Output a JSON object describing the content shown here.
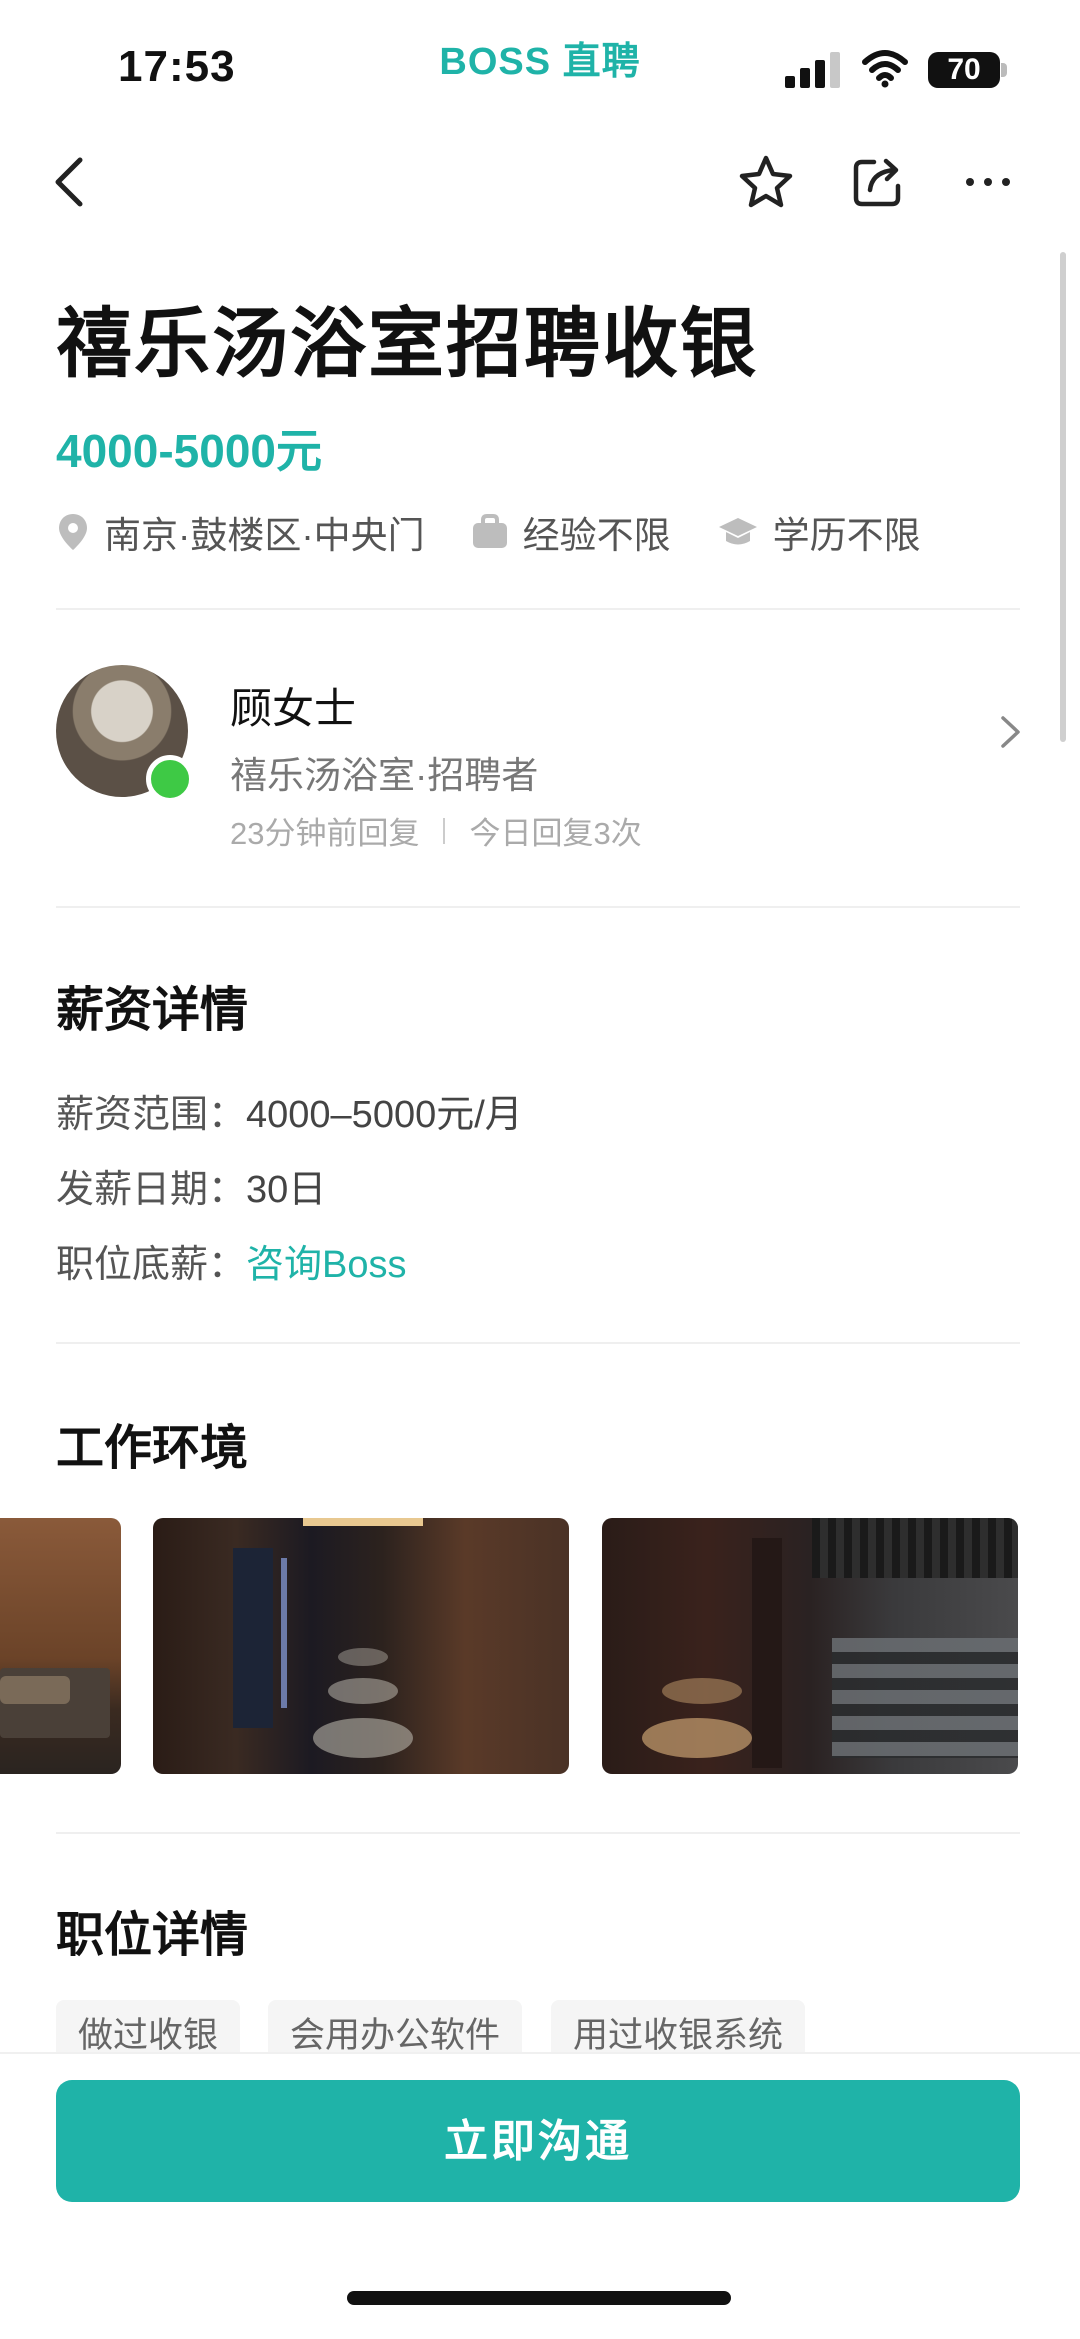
{
  "status_bar": {
    "time": "17:53",
    "brand": "BOSS 直聘",
    "battery": "70"
  },
  "nav": {
    "back_icon": "chevron-left-icon",
    "icons": [
      "star-icon",
      "share-icon",
      "more-icon"
    ]
  },
  "job": {
    "title": "禧乐汤浴室招聘收银",
    "salary": "4000-5000元",
    "location": "南京·鼓楼区·中央门",
    "experience": "经验不限",
    "education": "学历不限"
  },
  "recruiter": {
    "name": "顾女士",
    "company": "禧乐汤浴室·招聘者",
    "reply_time": "23分钟前回复",
    "reply_count": "今日回复3次",
    "online_color": "#3ec945"
  },
  "salary_details": {
    "title": "薪资详情",
    "range_label": "薪资范围：",
    "range_value": "4000–5000元/月",
    "payday_label": "发薪日期：",
    "payday_value": "30日",
    "base_label": "职位底薪：",
    "base_value": "咨询Boss"
  },
  "environment": {
    "title": "工作环境"
  },
  "job_details": {
    "title": "职位详情",
    "tags": [
      "做过收银",
      "会用办公软件",
      "用过收银系统"
    ]
  },
  "cta": {
    "label": "立即沟通"
  },
  "colors": {
    "accent": "#1fb3a8",
    "text": "#111111",
    "muted": "#777777"
  }
}
